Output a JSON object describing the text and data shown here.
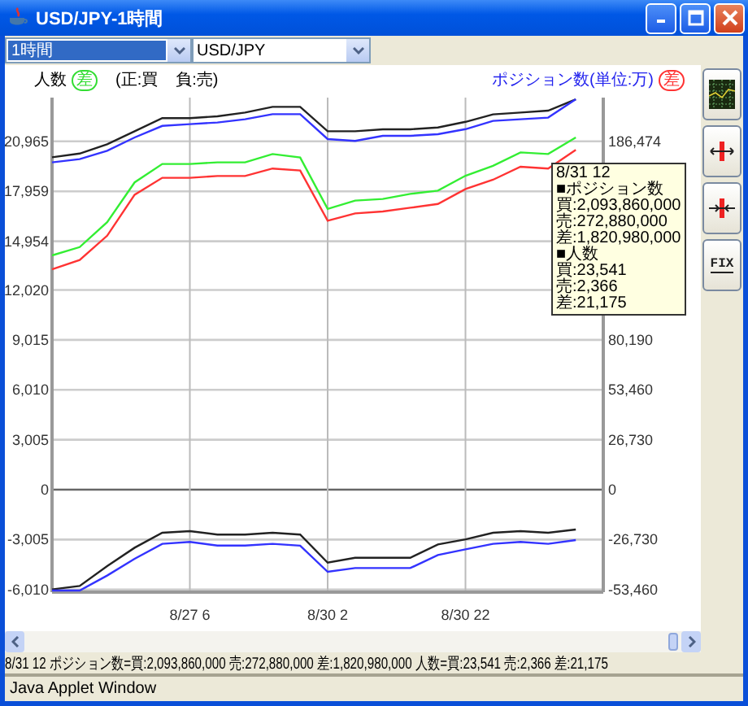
{
  "window": {
    "title": "USD/JPY-1時間"
  },
  "toolbar": {
    "period": "1時間",
    "pair": "USD/JPY"
  },
  "legend": {
    "left": {
      "label": "人数",
      "mark": "差",
      "color": "#33dd33"
    },
    "note": [
      "(正:買",
      "負:売)"
    ],
    "right": {
      "label": "ポジション数(単位:万)",
      "mark": "差",
      "color": "#ff3333"
    }
  },
  "chart_data": {
    "type": "line",
    "categories": [
      null,
      null,
      null,
      null,
      null,
      "8/27 6",
      null,
      null,
      null,
      null,
      "8/30 2",
      null,
      null,
      null,
      null,
      "8/30 22",
      null,
      null,
      null,
      null
    ],
    "ylim": [
      -6170,
      23600
    ],
    "y2lim": [
      -54900,
      210000
    ],
    "grid": true,
    "yticks": [
      {
        "value": -6010,
        "label": "-6,010"
      },
      {
        "value": -3005,
        "label": "-3,005"
      },
      {
        "value": 0,
        "label": "0"
      },
      {
        "value": 3005,
        "label": "3,005"
      },
      {
        "value": 6010,
        "label": "6,010"
      },
      {
        "value": 9015,
        "label": "9,015"
      },
      {
        "value": 12020,
        "label": "12,020"
      },
      {
        "value": 14954,
        "label": "14,954"
      },
      {
        "value": 17959,
        "label": "17,959"
      },
      {
        "value": 20965,
        "label": "20,965"
      }
    ],
    "y2ticks": [
      {
        "value": -53460,
        "label": "-53,460"
      },
      {
        "value": -26730,
        "label": "-26,730"
      },
      {
        "value": 0,
        "label": "0"
      },
      {
        "value": 26730,
        "label": "26,730"
      },
      {
        "value": 53460,
        "label": "53,460"
      },
      {
        "value": 80190,
        "label": "80,190"
      },
      {
        "value": 186474,
        "label": "186,474"
      }
    ],
    "series": [
      {
        "color": "#222222",
        "axis": "y2",
        "values": [
          178000,
          180000,
          185000,
          192000,
          199000,
          199000,
          200000,
          202000,
          205000,
          205000,
          192000,
          192000,
          193000,
          193000,
          194000,
          197000,
          201000,
          202000,
          203000,
          209000
        ]
      },
      {
        "color": "#3333ff",
        "values": [
          19700,
          19900,
          20400,
          21200,
          21900,
          22000,
          22100,
          22300,
          22600,
          22600,
          21100,
          21000,
          21300,
          21300,
          21400,
          21700,
          22200,
          22300,
          22400,
          23500
        ]
      },
      {
        "color": "#33ee33",
        "values": [
          14100,
          14600,
          16100,
          18500,
          19600,
          19600,
          19700,
          19700,
          20200,
          20000,
          16900,
          17400,
          17500,
          17800,
          18000,
          18900,
          19500,
          20300,
          20200,
          21200
        ]
      },
      {
        "color": "#ff3333",
        "axis": "y2",
        "values": [
          118000,
          123000,
          136000,
          158000,
          167000,
          167000,
          168000,
          168000,
          172000,
          171000,
          144000,
          148000,
          149000,
          151000,
          153000,
          161000,
          166000,
          173000,
          172000,
          182000
        ]
      },
      {
        "color": "#222222",
        "values": [
          -6000,
          -5800,
          -4600,
          -3500,
          -2600,
          -2500,
          -2700,
          -2700,
          -2600,
          -2700,
          -4400,
          -4100,
          -4100,
          -4100,
          -3300,
          -3000,
          -2600,
          -2500,
          -2600,
          -2400
        ]
      },
      {
        "color": "#3333ff",
        "axis": "y2",
        "values": [
          -54000,
          -54000,
          -46000,
          -37000,
          -29000,
          -28000,
          -30000,
          -30000,
          -29000,
          -30000,
          -44000,
          -42000,
          -42000,
          -42000,
          -35000,
          -32000,
          -29000,
          -28000,
          -29000,
          -27000
        ]
      }
    ]
  },
  "tooltip": [
    "8/31 12",
    "■ポジション数",
    "買:2,093,860,000",
    "売:272,880,000",
    "差:1,820,980,000",
    "■人数",
    "買:23,541",
    "売:2,366",
    "差:21,175"
  ],
  "sidebar": {
    "buttons": [
      {
        "kind": "grid"
      },
      {
        "kind": "expand"
      },
      {
        "kind": "shrink"
      },
      {
        "kind": "fix",
        "label": "FIX"
      }
    ]
  },
  "status_bar": "8/31 12  ポジション数=買:2,093,860,000 売:272,880,000 差:1,820,980,000 人数=買:23,541 売:2,366 差:21,175",
  "footer": "Java Applet Window"
}
